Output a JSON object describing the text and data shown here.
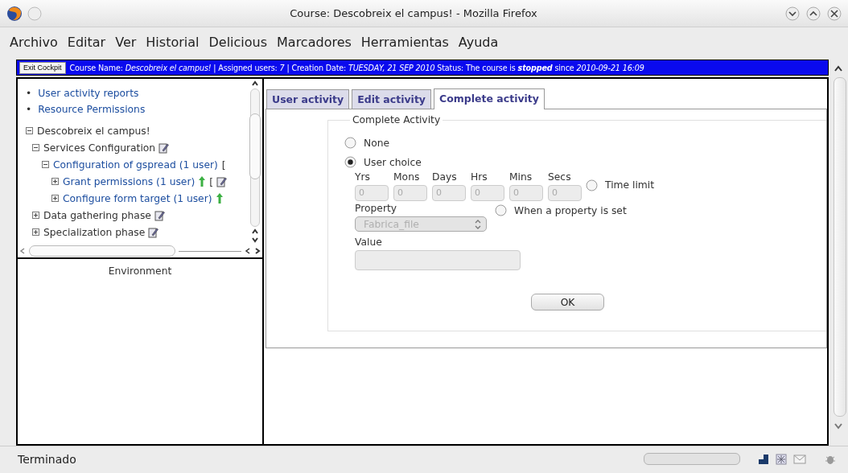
{
  "window": {
    "title": "Course: Descobreix el campus! - Mozilla Firefox"
  },
  "menu": [
    {
      "label": "Archivo"
    },
    {
      "label": "Editar"
    },
    {
      "label": "Ver"
    },
    {
      "label": "Historial"
    },
    {
      "label": "Delicious"
    },
    {
      "label": "Marcadores"
    },
    {
      "label": "Herramientas"
    },
    {
      "label": "Ayuda"
    }
  ],
  "cockpit": {
    "exit_button": "Exit Cockpit",
    "info": "Course Name: *Descobreix el campus!* | Assigned users: *7* | Creation Date: *TUESDAY, 21 SEP 2010* Status: The course is **stopped** since *2010-09-21 16:09*"
  },
  "sidebar": {
    "links": [
      {
        "bullet": "•",
        "label": "User activity reports"
      },
      {
        "bullet": "•",
        "label": "Resource Permissions"
      }
    ],
    "tree": [
      {
        "label": "Descobreix el campus!",
        "kind": "plain",
        "expanded": true,
        "note": false,
        "children": [
          {
            "label": "Services Configuration",
            "kind": "plain",
            "expanded": true,
            "note": true,
            "children": [
              {
                "label": "Configuration of gspread (1 user)",
                "kind": "link",
                "expanded": true,
                "note": false,
                "suffix": "[",
                "children": [
                  {
                    "label": "Grant permissions (1 user)",
                    "kind": "link",
                    "expanded": false,
                    "note": true,
                    "arrow": true,
                    "suffix": "["
                  },
                  {
                    "label": "Configure form target (1 user)",
                    "kind": "link",
                    "expanded": false,
                    "note": false,
                    "arrow": true
                  }
                ]
              }
            ]
          },
          {
            "label": "Data gathering phase",
            "kind": "plain",
            "expanded": false,
            "note": true
          },
          {
            "label": "Specialization phase",
            "kind": "plain",
            "expanded": false,
            "note": true
          }
        ]
      }
    ],
    "environment": "Environment"
  },
  "tabs": [
    {
      "label": "User activity",
      "selected": false
    },
    {
      "label": "Edit activity",
      "selected": false
    },
    {
      "label": "Complete activity",
      "selected": true
    }
  ],
  "complete_activity": {
    "legend": "Complete Activity",
    "options": [
      {
        "label": "None",
        "selected": false
      },
      {
        "label": "User choice",
        "selected": true
      }
    ],
    "time": {
      "disabled": true,
      "fields": [
        {
          "label": "Yrs",
          "value": "0"
        },
        {
          "label": "Mons",
          "value": "0"
        },
        {
          "label": "Days",
          "value": "0"
        },
        {
          "label": "Hrs",
          "value": "0"
        },
        {
          "label": "Mins",
          "value": "0"
        },
        {
          "label": "Secs",
          "value": "0"
        }
      ],
      "limit": {
        "label": "Time limit",
        "selected": false
      }
    },
    "property": {
      "label": "Property",
      "value": "Fabrica_file",
      "disabled": true,
      "condition": {
        "label": "When a property is set",
        "selected": false
      }
    },
    "value_field": {
      "label": "Value",
      "disabled": true
    },
    "ok": "OK"
  },
  "status_bar": {
    "text": "Terminado"
  }
}
